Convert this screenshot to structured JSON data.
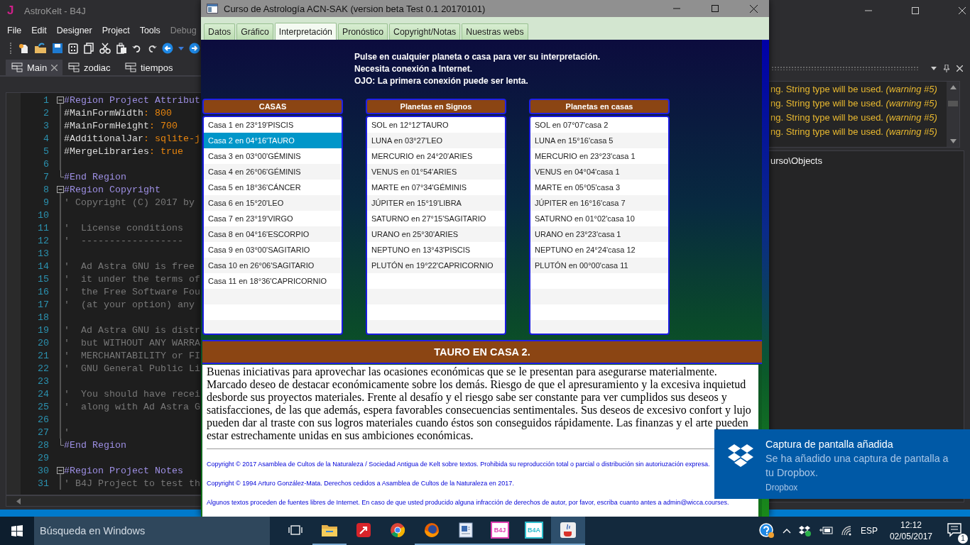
{
  "ide": {
    "logo": "J",
    "title": "AstroKelt - B4J",
    "menu": [
      {
        "label": "File",
        "disabled": false
      },
      {
        "label": "Edit",
        "disabled": false
      },
      {
        "label": "Designer",
        "disabled": false
      },
      {
        "label": "Project",
        "disabled": false
      },
      {
        "label": "Tools",
        "disabled": false
      },
      {
        "label": "Debug",
        "disabled": true
      }
    ],
    "tabs": [
      {
        "label": "Main",
        "selected": true,
        "closable": true
      },
      {
        "label": "zodiac",
        "selected": false,
        "closable": false
      },
      {
        "label": "tiempos",
        "selected": false,
        "closable": false
      }
    ],
    "code_lines": [
      {
        "n": "1",
        "kind": "start",
        "parts": [
          {
            "kind": "region",
            "text": "#Region Project Attribut"
          }
        ]
      },
      {
        "n": "2",
        "kind": "inside",
        "parts": [
          {
            "kind": "key",
            "text": "#MainFormWidth"
          },
          {
            "kind": "value",
            "text": ": 800"
          }
        ]
      },
      {
        "n": "3",
        "kind": "inside",
        "parts": [
          {
            "kind": "key",
            "text": "#MainFormHeight"
          },
          {
            "kind": "value",
            "text": ": 700"
          }
        ]
      },
      {
        "n": "4",
        "kind": "inside",
        "parts": [
          {
            "kind": "key",
            "text": "#AdditionalJar"
          },
          {
            "kind": "value",
            "text": ": sqlite-j"
          }
        ]
      },
      {
        "n": "5",
        "kind": "inside",
        "parts": [
          {
            "kind": "key",
            "text": "#MergeLibraries"
          },
          {
            "kind": "value",
            "text": ": true"
          }
        ]
      },
      {
        "n": "6",
        "kind": "inside"
      },
      {
        "n": "7",
        "kind": "end",
        "parts": [
          {
            "kind": "region",
            "text": "#End Region"
          }
        ]
      },
      {
        "n": "8",
        "kind": "start",
        "parts": [
          {
            "kind": "region",
            "text": "#Region Copyright"
          }
        ]
      },
      {
        "n": "9",
        "kind": "inside",
        "parts": [
          {
            "kind": "comment",
            "text": "' Copyright (C) 2017 by"
          }
        ]
      },
      {
        "n": "10",
        "kind": "inside"
      },
      {
        "n": "11",
        "kind": "inside",
        "parts": [
          {
            "kind": "comment",
            "text": "'  License conditions"
          }
        ]
      },
      {
        "n": "12",
        "kind": "inside",
        "parts": [
          {
            "kind": "comment",
            "text": "'  ------------------"
          }
        ]
      },
      {
        "n": "13",
        "kind": "inside"
      },
      {
        "n": "14",
        "kind": "inside",
        "parts": [
          {
            "kind": "comment",
            "text": "'  Ad Astra GNU is free"
          }
        ]
      },
      {
        "n": "15",
        "kind": "inside",
        "parts": [
          {
            "kind": "comment",
            "text": "'  it under the terms of"
          }
        ]
      },
      {
        "n": "16",
        "kind": "inside",
        "parts": [
          {
            "kind": "comment",
            "text": "'  the Free Software Fou"
          }
        ]
      },
      {
        "n": "17",
        "kind": "inside",
        "parts": [
          {
            "kind": "comment",
            "text": "'  (at your option) any"
          }
        ]
      },
      {
        "n": "18",
        "kind": "inside"
      },
      {
        "n": "19",
        "kind": "inside",
        "parts": [
          {
            "kind": "comment",
            "text": "'  Ad Astra GNU is distr"
          }
        ]
      },
      {
        "n": "20",
        "kind": "inside",
        "parts": [
          {
            "kind": "comment",
            "text": "'  but WITHOUT ANY WARRA"
          }
        ]
      },
      {
        "n": "21",
        "kind": "inside",
        "parts": [
          {
            "kind": "comment",
            "text": "'  MERCHANTABILITY or FI"
          }
        ]
      },
      {
        "n": "22",
        "kind": "inside",
        "parts": [
          {
            "kind": "comment",
            "text": "'  GNU General Public Li"
          }
        ]
      },
      {
        "n": "23",
        "kind": "inside"
      },
      {
        "n": "24",
        "kind": "inside",
        "parts": [
          {
            "kind": "comment",
            "text": "'  You should have recei"
          }
        ]
      },
      {
        "n": "25",
        "kind": "inside",
        "parts": [
          {
            "kind": "comment",
            "text": "'  along with Ad Astra G"
          }
        ]
      },
      {
        "n": "26",
        "kind": "inside"
      },
      {
        "n": "27",
        "kind": "inside",
        "parts": [
          {
            "kind": "comment",
            "text": "'"
          }
        ]
      },
      {
        "n": "28",
        "kind": "end",
        "parts": [
          {
            "kind": "region",
            "text": "#End Region"
          }
        ]
      },
      {
        "n": "29"
      },
      {
        "n": "30",
        "kind": "start",
        "parts": [
          {
            "kind": "region",
            "text": "#Region Project Notes"
          }
        ]
      },
      {
        "n": "31",
        "kind": "inside",
        "parts": [
          {
            "kind": "comment",
            "text": "' B4J Project to test th"
          }
        ]
      }
    ],
    "warnings": [
      "ng. String type will be used. *(warning #5)*",
      "ng. String type will be used. *(warning #5)*",
      "ng. String type will be used. *(warning #5)*",
      "ng. String type will be used. *(warning #5)*"
    ],
    "path": "urso\\Objects"
  },
  "dialog": {
    "title": "Curso de Astrología ACN-SAK (version beta Test 0.1 20170101)",
    "tabs": [
      {
        "label": "Datos",
        "selected": false
      },
      {
        "label": "Gráfico",
        "selected": false
      },
      {
        "label": "Interpretación",
        "selected": true
      },
      {
        "label": "Pronóstico",
        "selected": false
      },
      {
        "label": "Copyright/Notas",
        "selected": false
      },
      {
        "label": "Nuestras webs",
        "selected": false
      }
    ],
    "notice": [
      "Pulse en cualquier planeta o casa para ver su interpretación.",
      "Necesita conexión a Internet.",
      "OJO: La primera conexión puede ser lenta."
    ],
    "lists": [
      {
        "header": "CASAS",
        "items": [
          {
            "label": "Casa 1 en 23°19'PISCIS",
            "selected": false
          },
          {
            "label": "Casa 2 en 04°16'TAURO",
            "selected": true
          },
          {
            "label": "Casa 3 en 03°00'GÉMINIS",
            "selected": false
          },
          {
            "label": "Casa 4 en 26°06'GÉMINIS",
            "selected": false
          },
          {
            "label": "Casa 5 en 18°36'CÁNCER",
            "selected": false
          },
          {
            "label": "Casa 6 en 15°20'LEO",
            "selected": false
          },
          {
            "label": "Casa 7 en 23°19'VIRGO",
            "selected": false
          },
          {
            "label": "Casa 8 en 04°16'ESCORPIO",
            "selected": false
          },
          {
            "label": "Casa 9 en 03°00'SAGITARIO",
            "selected": false
          },
          {
            "label": "Casa 10 en 26°06'SAGITARIO",
            "selected": false
          },
          {
            "label": "Casa 11 en 18°36'CAPRICORNIO",
            "selected": false
          }
        ]
      },
      {
        "header": "Planetas en Signos",
        "items": [
          {
            "label": "SOL en 12°12'TAURO",
            "selected": false
          },
          {
            "label": "LUNA en 03°27'LEO",
            "selected": false
          },
          {
            "label": "MERCURIO en 24°20'ARIES",
            "selected": false
          },
          {
            "label": "VENUS en 01°54'ARIES",
            "selected": false
          },
          {
            "label": "MARTE en 07°34'GÉMINIS",
            "selected": false
          },
          {
            "label": "JÚPITER en 15°19'LIBRA",
            "selected": false
          },
          {
            "label": "SATURNO en 27°15'SAGITARIO",
            "selected": false
          },
          {
            "label": "URANO en 25°30'ARIES",
            "selected": false
          },
          {
            "label": "NEPTUNO en 13°43'PISCIS",
            "selected": false
          },
          {
            "label": "PLUTÓN en 19°22'CAPRICORNIO",
            "selected": false
          }
        ]
      },
      {
        "header": "Planetas en casas",
        "items": [
          {
            "label": "SOL en 07°07'casa 2",
            "selected": false
          },
          {
            "label": "LUNA en 15°16'casa 5",
            "selected": false
          },
          {
            "label": "MERCURIO en 23°23'casa 1",
            "selected": false
          },
          {
            "label": "VENUS en 04°04'casa 1",
            "selected": false
          },
          {
            "label": "MARTE en 05°05'casa 3",
            "selected": false
          },
          {
            "label": "JÚPITER en 16°16'casa 7",
            "selected": false
          },
          {
            "label": "SATURNO en 01°02'casa 10",
            "selected": false
          },
          {
            "label": "URANO en 23°23'casa 1",
            "selected": false
          },
          {
            "label": "NEPTUNO en 24°24'casa 12",
            "selected": false
          },
          {
            "label": "PLUTÓN en 00°00'casa 11",
            "selected": false
          }
        ]
      }
    ],
    "detail": {
      "title": "TAURO EN CASA 2.",
      "body": "Buenas iniciativas para aprovechar las ocasiones económicas que se le presentan para asegurarse materialmente. Marcado deseo de destacar económicamente sobre los demás. Riesgo de que el apresuramiento y la excesiva inquietud desborde sus proyectos materiales. Frente al desafío y el riesgo sabe ser constante para ver cumplidos sus deseos y satisfacciones, de las que además, espera favorables consecuencias sentimentales. Sus deseos de excesivo confort y lujo pueden dar al traste con sus logros materiales cuando éstos son conseguidos rápidamente. Las finanzas y el arte pueden estar estrechamente unidas en sus ambiciones económicas.",
      "copyright": [
        "Copyright © 2017 Asamblea de Cultos de la Naturaleza / Sociedad Antigua de Kelt sobre textos. Prohibida su reproducción total o parcial o distribución sin autoriuzación expresa.",
        "Copyright © 1994 Arturo González-Mata. Derechos cedidos a Asamblea de Cultos de la Naturaleza en 2017.",
        "Algunos textos proceden de fuentes libres de Internet. En caso de que usted producido alguna infracción de derechos de autor, por favor, escriba cuanto antes a admin@wicca.courses."
      ]
    }
  },
  "notification": {
    "title": "Captura de pantalla añadida",
    "body": "Se ha añadido una captura de pantalla a tu Dropbox.",
    "source": "Dropbox"
  },
  "taskbar": {
    "search": "Búsqueda en Windows",
    "apps": [
      {
        "kind": "taskview",
        "running": false,
        "active": false
      },
      {
        "kind": "folder",
        "running": true,
        "active": false
      },
      {
        "kind": "redapp",
        "running": false,
        "active": false
      },
      {
        "kind": "chrome",
        "running": false,
        "active": false
      },
      {
        "kind": "firefox",
        "running": true,
        "active": false
      },
      {
        "kind": "document",
        "running": true,
        "active": false
      },
      {
        "kind": "label",
        "label": "B4J",
        "color": "#e040b0",
        "running": true,
        "active": false
      },
      {
        "kind": "label",
        "label": "B4A",
        "color": "#30c0d0",
        "running": true,
        "active": false
      },
      {
        "kind": "java",
        "running": true,
        "active": true
      }
    ],
    "language": "ESP",
    "time": "12:12",
    "date": "02/05/2017",
    "badge": "1"
  }
}
